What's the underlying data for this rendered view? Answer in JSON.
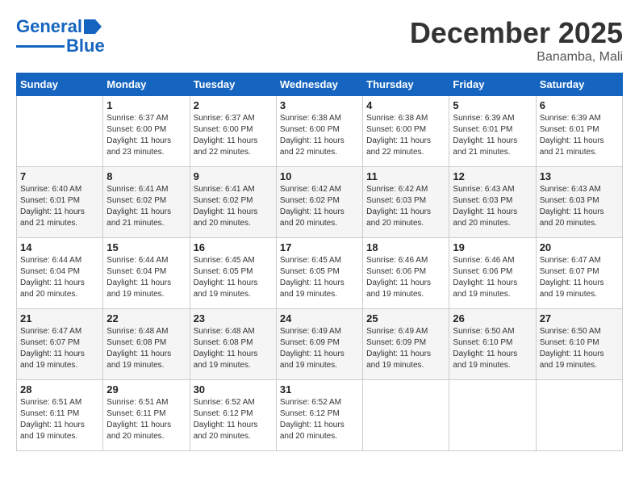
{
  "logo": {
    "line1": "General",
    "line2": "Blue"
  },
  "title": "December 2025",
  "location": "Banamba, Mali",
  "days_header": [
    "Sunday",
    "Monday",
    "Tuesday",
    "Wednesday",
    "Thursday",
    "Friday",
    "Saturday"
  ],
  "weeks": [
    [
      {
        "day": "",
        "sunrise": "",
        "sunset": "",
        "daylight": ""
      },
      {
        "day": "1",
        "sunrise": "Sunrise: 6:37 AM",
        "sunset": "Sunset: 6:00 PM",
        "daylight": "Daylight: 11 hours and 23 minutes."
      },
      {
        "day": "2",
        "sunrise": "Sunrise: 6:37 AM",
        "sunset": "Sunset: 6:00 PM",
        "daylight": "Daylight: 11 hours and 22 minutes."
      },
      {
        "day": "3",
        "sunrise": "Sunrise: 6:38 AM",
        "sunset": "Sunset: 6:00 PM",
        "daylight": "Daylight: 11 hours and 22 minutes."
      },
      {
        "day": "4",
        "sunrise": "Sunrise: 6:38 AM",
        "sunset": "Sunset: 6:00 PM",
        "daylight": "Daylight: 11 hours and 22 minutes."
      },
      {
        "day": "5",
        "sunrise": "Sunrise: 6:39 AM",
        "sunset": "Sunset: 6:01 PM",
        "daylight": "Daylight: 11 hours and 21 minutes."
      },
      {
        "day": "6",
        "sunrise": "Sunrise: 6:39 AM",
        "sunset": "Sunset: 6:01 PM",
        "daylight": "Daylight: 11 hours and 21 minutes."
      }
    ],
    [
      {
        "day": "7",
        "sunrise": "Sunrise: 6:40 AM",
        "sunset": "Sunset: 6:01 PM",
        "daylight": "Daylight: 11 hours and 21 minutes."
      },
      {
        "day": "8",
        "sunrise": "Sunrise: 6:41 AM",
        "sunset": "Sunset: 6:02 PM",
        "daylight": "Daylight: 11 hours and 21 minutes."
      },
      {
        "day": "9",
        "sunrise": "Sunrise: 6:41 AM",
        "sunset": "Sunset: 6:02 PM",
        "daylight": "Daylight: 11 hours and 20 minutes."
      },
      {
        "day": "10",
        "sunrise": "Sunrise: 6:42 AM",
        "sunset": "Sunset: 6:02 PM",
        "daylight": "Daylight: 11 hours and 20 minutes."
      },
      {
        "day": "11",
        "sunrise": "Sunrise: 6:42 AM",
        "sunset": "Sunset: 6:03 PM",
        "daylight": "Daylight: 11 hours and 20 minutes."
      },
      {
        "day": "12",
        "sunrise": "Sunrise: 6:43 AM",
        "sunset": "Sunset: 6:03 PM",
        "daylight": "Daylight: 11 hours and 20 minutes."
      },
      {
        "day": "13",
        "sunrise": "Sunrise: 6:43 AM",
        "sunset": "Sunset: 6:03 PM",
        "daylight": "Daylight: 11 hours and 20 minutes."
      }
    ],
    [
      {
        "day": "14",
        "sunrise": "Sunrise: 6:44 AM",
        "sunset": "Sunset: 6:04 PM",
        "daylight": "Daylight: 11 hours and 20 minutes."
      },
      {
        "day": "15",
        "sunrise": "Sunrise: 6:44 AM",
        "sunset": "Sunset: 6:04 PM",
        "daylight": "Daylight: 11 hours and 19 minutes."
      },
      {
        "day": "16",
        "sunrise": "Sunrise: 6:45 AM",
        "sunset": "Sunset: 6:05 PM",
        "daylight": "Daylight: 11 hours and 19 minutes."
      },
      {
        "day": "17",
        "sunrise": "Sunrise: 6:45 AM",
        "sunset": "Sunset: 6:05 PM",
        "daylight": "Daylight: 11 hours and 19 minutes."
      },
      {
        "day": "18",
        "sunrise": "Sunrise: 6:46 AM",
        "sunset": "Sunset: 6:06 PM",
        "daylight": "Daylight: 11 hours and 19 minutes."
      },
      {
        "day": "19",
        "sunrise": "Sunrise: 6:46 AM",
        "sunset": "Sunset: 6:06 PM",
        "daylight": "Daylight: 11 hours and 19 minutes."
      },
      {
        "day": "20",
        "sunrise": "Sunrise: 6:47 AM",
        "sunset": "Sunset: 6:07 PM",
        "daylight": "Daylight: 11 hours and 19 minutes."
      }
    ],
    [
      {
        "day": "21",
        "sunrise": "Sunrise: 6:47 AM",
        "sunset": "Sunset: 6:07 PM",
        "daylight": "Daylight: 11 hours and 19 minutes."
      },
      {
        "day": "22",
        "sunrise": "Sunrise: 6:48 AM",
        "sunset": "Sunset: 6:08 PM",
        "daylight": "Daylight: 11 hours and 19 minutes."
      },
      {
        "day": "23",
        "sunrise": "Sunrise: 6:48 AM",
        "sunset": "Sunset: 6:08 PM",
        "daylight": "Daylight: 11 hours and 19 minutes."
      },
      {
        "day": "24",
        "sunrise": "Sunrise: 6:49 AM",
        "sunset": "Sunset: 6:09 PM",
        "daylight": "Daylight: 11 hours and 19 minutes."
      },
      {
        "day": "25",
        "sunrise": "Sunrise: 6:49 AM",
        "sunset": "Sunset: 6:09 PM",
        "daylight": "Daylight: 11 hours and 19 minutes."
      },
      {
        "day": "26",
        "sunrise": "Sunrise: 6:50 AM",
        "sunset": "Sunset: 6:10 PM",
        "daylight": "Daylight: 11 hours and 19 minutes."
      },
      {
        "day": "27",
        "sunrise": "Sunrise: 6:50 AM",
        "sunset": "Sunset: 6:10 PM",
        "daylight": "Daylight: 11 hours and 19 minutes."
      }
    ],
    [
      {
        "day": "28",
        "sunrise": "Sunrise: 6:51 AM",
        "sunset": "Sunset: 6:11 PM",
        "daylight": "Daylight: 11 hours and 19 minutes."
      },
      {
        "day": "29",
        "sunrise": "Sunrise: 6:51 AM",
        "sunset": "Sunset: 6:11 PM",
        "daylight": "Daylight: 11 hours and 20 minutes."
      },
      {
        "day": "30",
        "sunrise": "Sunrise: 6:52 AM",
        "sunset": "Sunset: 6:12 PM",
        "daylight": "Daylight: 11 hours and 20 minutes."
      },
      {
        "day": "31",
        "sunrise": "Sunrise: 6:52 AM",
        "sunset": "Sunset: 6:12 PM",
        "daylight": "Daylight: 11 hours and 20 minutes."
      },
      {
        "day": "",
        "sunrise": "",
        "sunset": "",
        "daylight": ""
      },
      {
        "day": "",
        "sunrise": "",
        "sunset": "",
        "daylight": ""
      },
      {
        "day": "",
        "sunrise": "",
        "sunset": "",
        "daylight": ""
      }
    ]
  ]
}
